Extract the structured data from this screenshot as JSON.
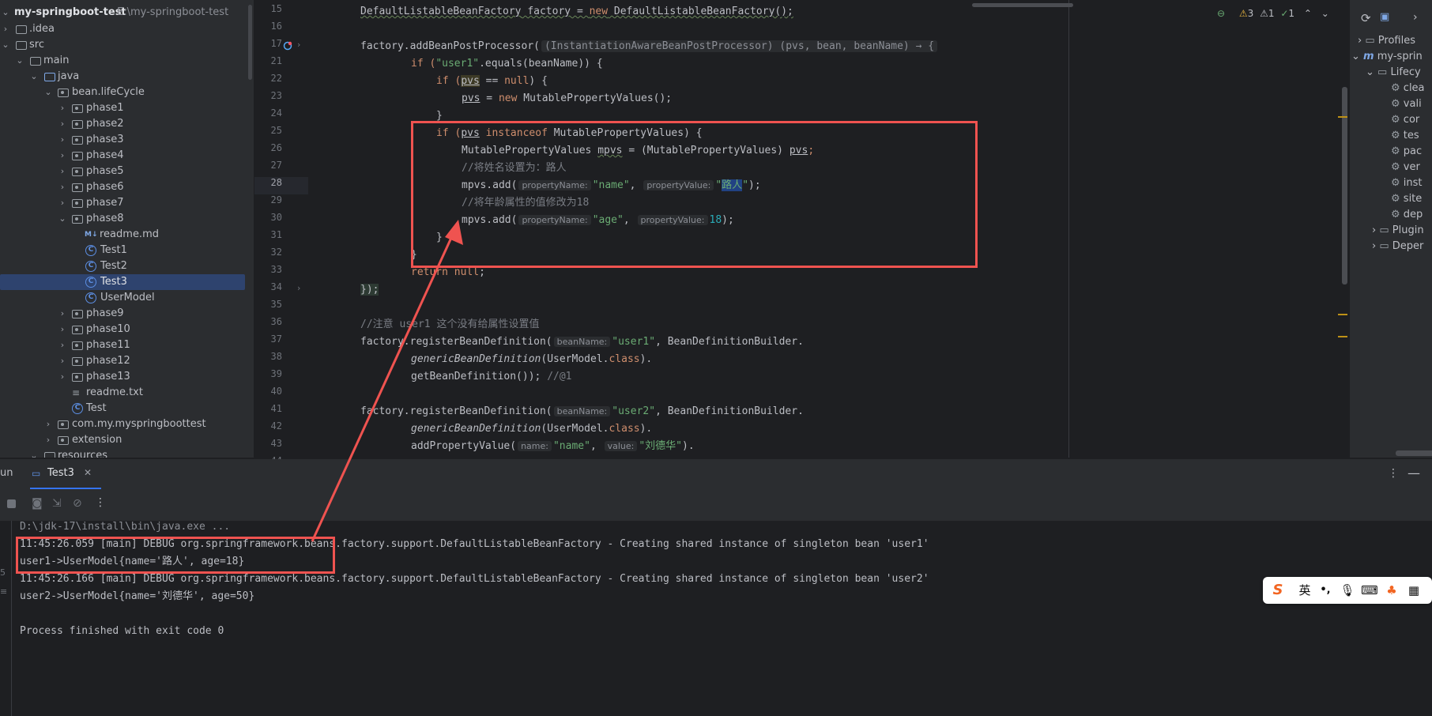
{
  "project": {
    "root_name": "my-springboot-test",
    "root_path": "E:\\my-springboot-test",
    "items": [
      {
        "label": ".idea"
      },
      {
        "label": "src"
      },
      {
        "label": "main"
      },
      {
        "label": "java"
      },
      {
        "label": "bean.lifeCycle"
      },
      {
        "label": "phase1"
      },
      {
        "label": "phase2"
      },
      {
        "label": "phase3"
      },
      {
        "label": "phase4"
      },
      {
        "label": "phase5"
      },
      {
        "label": "phase6"
      },
      {
        "label": "phase7"
      },
      {
        "label": "phase8"
      },
      {
        "label": "readme.md"
      },
      {
        "label": "Test1"
      },
      {
        "label": "Test2"
      },
      {
        "label": "Test3"
      },
      {
        "label": "UserModel"
      },
      {
        "label": "phase9"
      },
      {
        "label": "phase10"
      },
      {
        "label": "phase11"
      },
      {
        "label": "phase12"
      },
      {
        "label": "phase13"
      },
      {
        "label": "readme.txt"
      },
      {
        "label": "Test"
      },
      {
        "label": "com.my.myspringboottest"
      },
      {
        "label": "extension"
      },
      {
        "label": "resources"
      }
    ]
  },
  "editor": {
    "inspections": {
      "warnings": "3",
      "weak_warnings": "1",
      "ok": "1"
    },
    "line_numbers": [
      "15",
      "16",
      "17",
      "21",
      "22",
      "23",
      "24",
      "25",
      "26",
      "27",
      "28",
      "29",
      "30",
      "31",
      "32",
      "33",
      "34",
      "35",
      "36",
      "37",
      "38",
      "39",
      "40",
      "41",
      "42",
      "43",
      "44"
    ],
    "code": {
      "l15_a": "DefaultListableBeanFactory",
      "l15_b": " factory = ",
      "l15_c": "new",
      "l15_d": " DefaultListableBeanFactory();",
      "l17_a": "factory.addBeanPostProcessor(",
      "l17_b": "(InstantiationAwareBeanPostProcessor) (pvs, bean, beanName) → {",
      "l21_a": "if (",
      "l21_b": "\"user1\"",
      "l21_c": ".equals(beanName)) {",
      "l22_a": "if (",
      "l22_b": "pvs",
      "l22_c": " == ",
      "l22_d": "null",
      "l22_e": ") {",
      "l23_a": "pvs",
      "l23_b": " = ",
      "l23_c": "new",
      "l23_d": " MutablePropertyValues();",
      "l24": "}",
      "l25_a": "if (",
      "l25_b": "pvs",
      "l25_c": " instanceof",
      "l25_d": " MutablePropertyValues) {",
      "l26_a": "MutablePropertyValues ",
      "l26_b": "mpvs",
      "l26_c": " = (MutablePropertyValues) ",
      "l26_d": "pvs",
      "l26_e": ";",
      "l27": "//将姓名设置为：路人",
      "l28_a": "mpvs.add(",
      "l28_hint": "propertyName:",
      "l28_b": "\"name\"",
      "l28_c": ",",
      "l28_hint2": "propertyValue:",
      "l28_d": "\"",
      "l28_e": "路人",
      "l28_f": "\"",
      "l28_g": ");",
      "l29": "//将年龄属性的值修改为18",
      "l30_a": "mpvs.add(",
      "l30_hint": "propertyName:",
      "l30_b": "\"age\"",
      "l30_c": ",",
      "l30_hint2": "propertyValue:",
      "l30_d": "18",
      "l30_e": ");",
      "l31": "}",
      "l32": "}",
      "l33_a": "return",
      "l33_b": " null",
      "l33_c": ";",
      "l34": "});",
      "l37": "//注意 user1 这个没有给属性设置值",
      "l38_a": "factory.registerBeanDefinition(",
      "l38_hint": "beanName:",
      "l38_b": "\"user1\"",
      "l38_c": ", BeanDefinitionBuilder.",
      "l39_a": "genericBeanDefinition",
      "l39_b": "(UserModel.",
      "l39_c": "class",
      "l39_d": ").",
      "l40_a": "getBeanDefinition()); ",
      "l40_b": "//@1",
      "l42_a": "factory.registerBeanDefinition(",
      "l42_hint": "beanName:",
      "l42_b": "\"user2\"",
      "l42_c": ", BeanDefinitionBuilder.",
      "l43_a": "genericBeanDefinition",
      "l43_b": "(UserModel.",
      "l43_c": "class",
      "l43_d": ").",
      "l44_a": "addPropertyValue(",
      "l44_hint": "name:",
      "l44_b": "\"name\"",
      "l44_c": ",",
      "l44_hint2": "value:",
      "l44_d": "\"刘德华\"",
      "l44_e": ")."
    }
  },
  "maven": {
    "items": [
      {
        "label": "Profiles"
      },
      {
        "label": "my-sprin"
      },
      {
        "label": "Lifecy"
      },
      {
        "label": "clea"
      },
      {
        "label": "vali"
      },
      {
        "label": "cor"
      },
      {
        "label": "tes"
      },
      {
        "label": "pac"
      },
      {
        "label": "ver"
      },
      {
        "label": "inst"
      },
      {
        "label": "site"
      },
      {
        "label": "dep"
      },
      {
        "label": "Plugin"
      },
      {
        "label": "Deper"
      }
    ]
  },
  "run": {
    "panel_label": "un",
    "tab_label": "Test3",
    "console": [
      "D:\\jdk-17\\install\\bin\\java.exe ...",
      "11:45:26.059 [main] DEBUG org.springframework.beans.factory.support.DefaultListableBeanFactory - Creating shared instance of singleton bean 'user1'",
      "user1->UserModel{name='路人', age=18}",
      "11:45:26.166 [main] DEBUG org.springframework.beans.factory.support.DefaultListableBeanFactory - Creating shared instance of singleton bean 'user2'",
      "user2->UserModel{name='刘德华', age=50}",
      "",
      "Process finished with exit code 0"
    ]
  },
  "ime": {
    "lang": "英",
    "punct": "•,"
  }
}
